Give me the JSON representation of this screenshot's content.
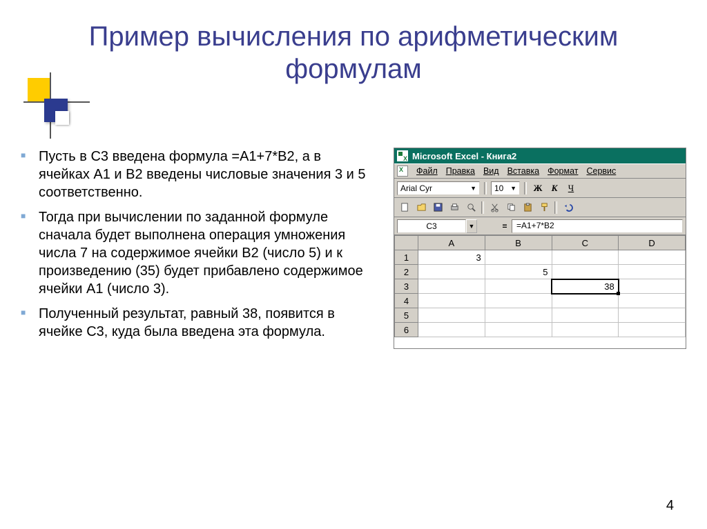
{
  "title": "Пример вычисления по арифметическим формулам",
  "bullets": [
    "Пусть в С3 введена формула =А1+7*В2, а в ячейках А1 и В2 введены числовые значения 3 и 5 соответственно.",
    "Тогда при вычислении по заданной формуле сначала будет выполнена операция умножения числа 7 на содержимое ячейки B2 (число 5) и к произведению (35) будет прибавлено содержимое ячейки А1 (число 3).",
    "Полученный результат, равный 38, появится в ячейке С3, куда была введена эта формула."
  ],
  "excel": {
    "titlebar": "Microsoft Excel - Книга2",
    "menus": [
      "Файл",
      "Правка",
      "Вид",
      "Вставка",
      "Формат",
      "Сервис"
    ],
    "font_name": "Arial Cyr",
    "font_size": "10",
    "fmt": {
      "bold": "Ж",
      "italic": "К",
      "underline": "Ч"
    },
    "name_box": "C3",
    "formula": "=A1+7*B2",
    "headers": [
      "A",
      "B",
      "C",
      "D"
    ],
    "rows": [
      "1",
      "2",
      "3",
      "4",
      "5",
      "6"
    ],
    "cells": {
      "A1": "3",
      "B2": "5",
      "C3": "38"
    }
  },
  "page_number": "4"
}
